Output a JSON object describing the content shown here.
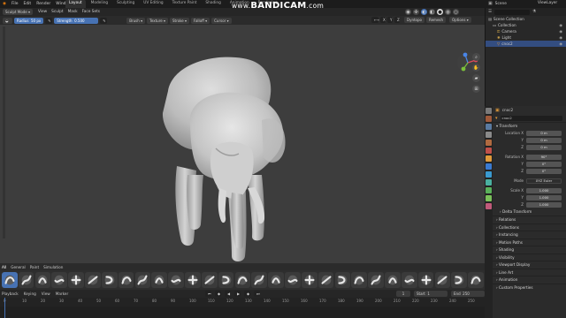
{
  "menu": [
    "File",
    "Edit",
    "Render",
    "Window",
    "Help"
  ],
  "workspace_tabs": [
    {
      "label": "Layout",
      "active": true
    },
    {
      "label": "Modeling",
      "active": false
    },
    {
      "label": "Sculpting",
      "active": false
    },
    {
      "label": "UV Editing",
      "active": false
    },
    {
      "label": "Texture Paint",
      "active": false
    },
    {
      "label": "Shading",
      "active": false
    },
    {
      "label": "Animation",
      "active": false
    },
    {
      "label": "Rendering",
      "active": false
    }
  ],
  "watermark": {
    "www": "www.",
    "brand": "BANDICAM",
    "tld": ".com"
  },
  "scene": {
    "label": "Scene",
    "view_layer": "ViewLayer"
  },
  "header1": {
    "mode": "Sculpt Mode",
    "menus": [
      "View",
      "Sculpt",
      "Mask",
      "Face Sets"
    ],
    "brush_menus": [
      "Brush",
      "Texture",
      "Stroke",
      "Falloff",
      "Cursor"
    ],
    "dyntopo": "Dyntopo",
    "remesh": "Remesh",
    "options": "Options"
  },
  "header2": {
    "radius_label": "Radius",
    "radius_value": "50 px",
    "strength_label": "Strength",
    "strength_value": "0.500"
  },
  "shelf_tabs": [
    "All",
    "General",
    "Paint",
    "Simulation"
  ],
  "brush_count": 29,
  "timeline": {
    "menus": [
      "Playback",
      "Keying",
      "View",
      "Marker"
    ],
    "current_frame": "1",
    "start_label": "Start",
    "start_value": "1",
    "end_label": "End",
    "end_value": "250",
    "ticks": [
      "0",
      "10",
      "20",
      "30",
      "40",
      "50",
      "60",
      "70",
      "80",
      "90",
      "100",
      "110",
      "120",
      "130",
      "140",
      "150",
      "160",
      "170",
      "180",
      "190",
      "200",
      "210",
      "220",
      "230",
      "240",
      "250"
    ]
  },
  "outliner": {
    "root": "Scene Collection",
    "items": [
      {
        "label": "Collection",
        "indent": 1,
        "selected": false,
        "icon": "collection-icon"
      },
      {
        "label": "Camera",
        "indent": 2,
        "selected": false,
        "icon": "camera-icon"
      },
      {
        "label": "Light",
        "indent": 2,
        "selected": false,
        "icon": "light-icon"
      },
      {
        "label": "cnoc2",
        "indent": 2,
        "selected": true,
        "icon": "mesh-icon"
      }
    ]
  },
  "properties": {
    "object_name": "cnoc2",
    "object_field": "cnoc2",
    "transform_label": "Transform",
    "location": {
      "label": "Location X",
      "x": "0 m",
      "y": "0 m",
      "z": "0 m"
    },
    "rotation": {
      "label": "Rotation X",
      "x": "90°",
      "y": "0°",
      "z": "0°"
    },
    "mode_label": "Mode",
    "mode_value": "XYZ Euler",
    "scale": {
      "label": "Scale X",
      "x": "1.000",
      "y": "1.000",
      "z": "1.000"
    },
    "delta_label": "Delta Transform",
    "sections": [
      "Relations",
      "Collections",
      "Instancing",
      "Motion Paths",
      "Shading",
      "Visibility",
      "Viewport Display",
      "Line Art",
      "Animation",
      "Custom Properties"
    ]
  },
  "colors": {
    "accent": "#4772b3",
    "viewport": "#3d3d3d",
    "model": "#c9c9c9"
  }
}
